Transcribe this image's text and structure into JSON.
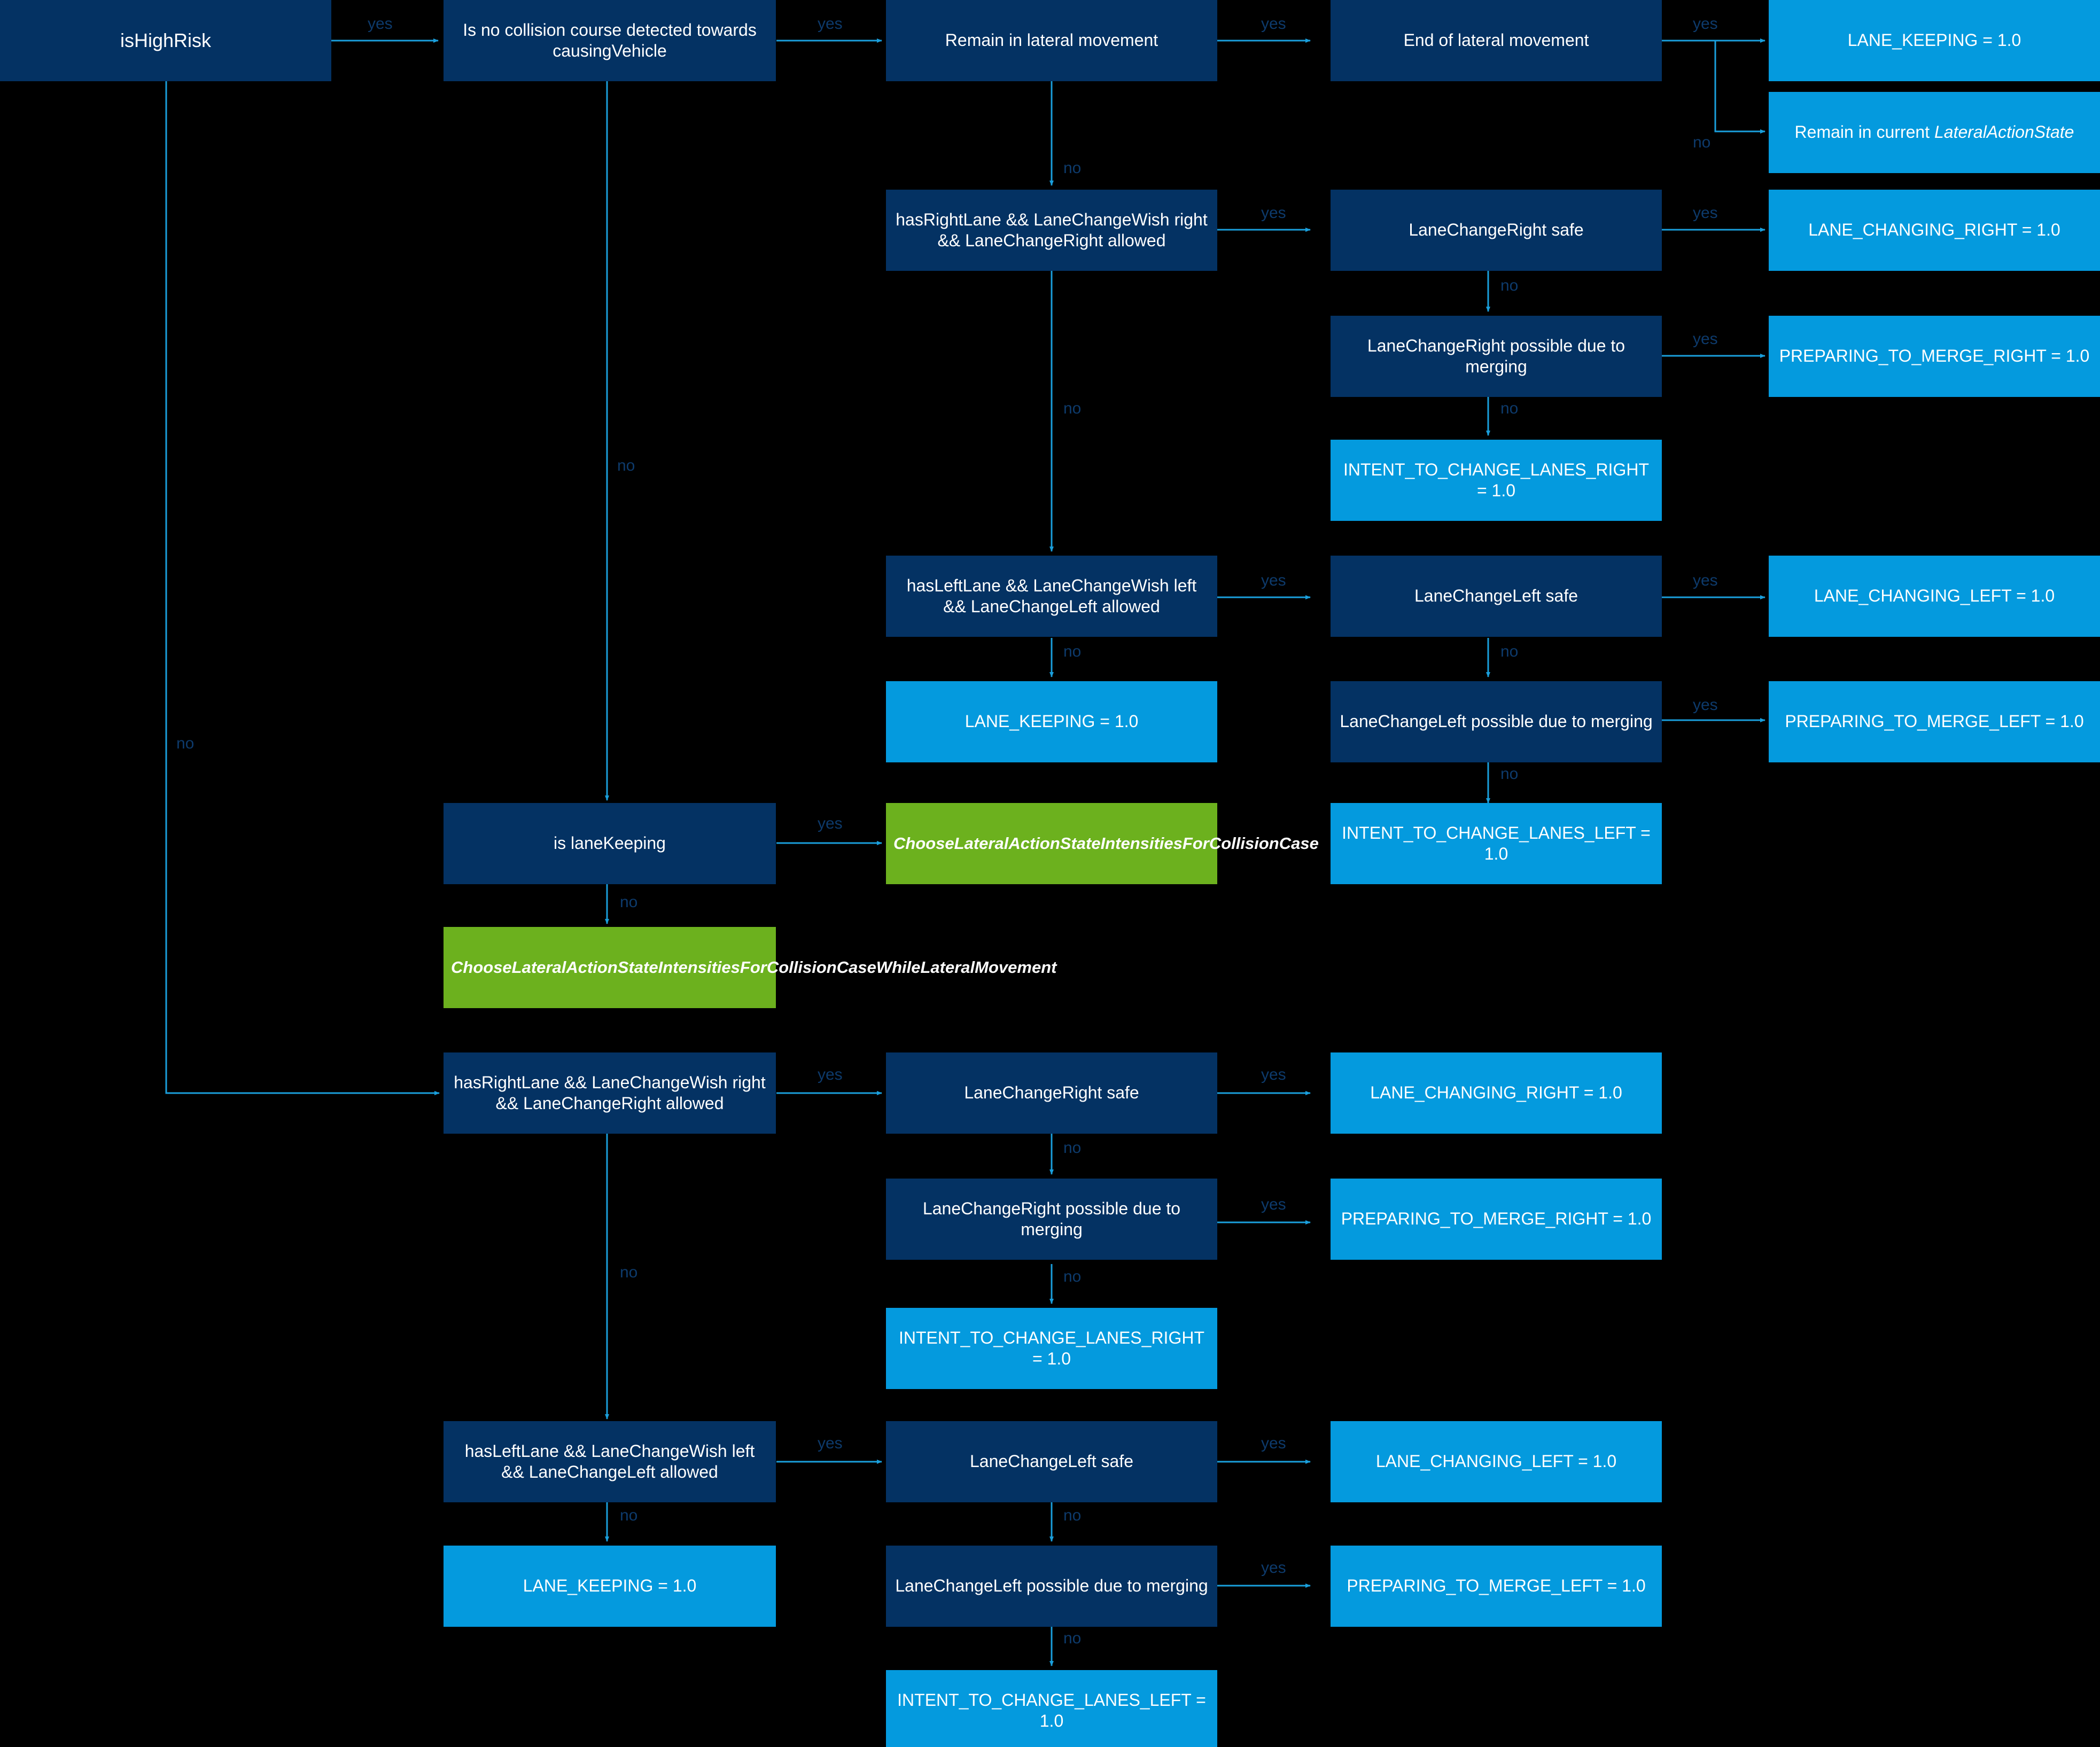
{
  "diagram": {
    "title": "LateralActionState decision flowchart",
    "background": "#000000",
    "colors": {
      "decision_box": "#043263",
      "outcome_box": "#049ade",
      "subroutine_box": "#6cb11e",
      "edge_line": "#1a9fdc",
      "edge_label": "#0d3a6b",
      "node_text": "#ffffff"
    },
    "nodes": [
      {
        "id": "isHighRisk",
        "label": "isHighRisk",
        "type": "decision"
      },
      {
        "id": "noCollisionCourse",
        "label": "Is no collision course detected towards causingVehicle",
        "type": "decision"
      },
      {
        "id": "remainLateral",
        "label": "Remain in lateral movement",
        "type": "decision"
      },
      {
        "id": "endLateral",
        "label": "End of lateral movement",
        "type": "decision"
      },
      {
        "id": "laneKeeping1",
        "label": "LANE_KEEPING = 1.0",
        "type": "outcome"
      },
      {
        "id": "remainCurrentState",
        "label": "Remain in current LateralActionState",
        "type": "outcome",
        "italic_tail": "LateralActionState"
      },
      {
        "id": "hasRightLaneA",
        "label": "hasRightLane && LaneChangeWish right && LaneChangeRight allowed",
        "type": "decision"
      },
      {
        "id": "lcrSafeA",
        "label": "LaneChangeRight safe",
        "type": "decision"
      },
      {
        "id": "laneChangingRightA",
        "label": "LANE_CHANGING_RIGHT = 1.0",
        "type": "outcome"
      },
      {
        "id": "lcrMergeA",
        "label": "LaneChangeRight possible due to merging",
        "type": "decision"
      },
      {
        "id": "prepMergeRightA",
        "label": "PREPARING_TO_MERGE_RIGHT = 1.0",
        "type": "outcome"
      },
      {
        "id": "intentRightA",
        "label": "INTENT_TO_CHANGE_LANES_RIGHT = 1.0",
        "type": "outcome"
      },
      {
        "id": "hasLeftLaneA",
        "label": "hasLeftLane && LaneChangeWish left && LaneChangeLeft allowed",
        "type": "decision"
      },
      {
        "id": "lclSafeA",
        "label": "LaneChangeLeft safe",
        "type": "decision"
      },
      {
        "id": "laneChangingLeftA",
        "label": "LANE_CHANGING_LEFT = 1.0",
        "type": "outcome"
      },
      {
        "id": "laneKeepingA",
        "label": "LANE_KEEPING = 1.0",
        "type": "outcome"
      },
      {
        "id": "lclMergeA",
        "label": "LaneChangeLeft possible due to merging",
        "type": "decision"
      },
      {
        "id": "prepMergeLeftA",
        "label": "PREPARING_TO_MERGE_LEFT = 1.0",
        "type": "outcome"
      },
      {
        "id": "intentLeftA",
        "label": "INTENT_TO_CHANGE_LANES_LEFT = 1.0",
        "type": "outcome"
      },
      {
        "id": "isLaneKeeping",
        "label": "is laneKeeping",
        "type": "decision"
      },
      {
        "id": "chooseCollision",
        "label": "ChooseLateralActionStateIntensitiesForCollisionCase",
        "type": "subroutine"
      },
      {
        "id": "chooseCollisionLateral",
        "label": "ChooseLateralActionStateIntensitiesForCollisionCaseWhileLateralMovement",
        "type": "subroutine"
      },
      {
        "id": "hasRightLaneB",
        "label": "hasRightLane && LaneChangeWish right && LaneChangeRight allowed",
        "type": "decision"
      },
      {
        "id": "lcrSafeB",
        "label": "LaneChangeRight safe",
        "type": "decision"
      },
      {
        "id": "laneChangingRightB",
        "label": "LANE_CHANGING_RIGHT = 1.0",
        "type": "outcome"
      },
      {
        "id": "lcrMergeB",
        "label": "LaneChangeRight possible due to merging",
        "type": "decision"
      },
      {
        "id": "prepMergeRightB",
        "label": "PREPARING_TO_MERGE_RIGHT = 1.0",
        "type": "outcome"
      },
      {
        "id": "intentRightB",
        "label": "INTENT_TO_CHANGE_LANES_RIGHT = 1.0",
        "type": "outcome"
      },
      {
        "id": "hasLeftLaneB",
        "label": "hasLeftLane && LaneChangeWish left && LaneChangeLeft allowed",
        "type": "decision"
      },
      {
        "id": "lclSafeB",
        "label": "LaneChangeLeft safe",
        "type": "decision"
      },
      {
        "id": "laneChangingLeftB",
        "label": "LANE_CHANGING_LEFT = 1.0",
        "type": "outcome"
      },
      {
        "id": "laneKeepingB",
        "label": "LANE_KEEPING = 1.0",
        "type": "outcome"
      },
      {
        "id": "lclMergeB",
        "label": "LaneChangeLeft possible due to merging",
        "type": "decision"
      },
      {
        "id": "prepMergeLeftB",
        "label": "PREPARING_TO_MERGE_LEFT = 1.0",
        "type": "outcome"
      },
      {
        "id": "intentLeftB",
        "label": "INTENT_TO_CHANGE_LANES_LEFT = 1.0",
        "type": "outcome"
      }
    ],
    "edge_labels": {
      "e1": "yes",
      "e2": "no",
      "e3": "yes",
      "e4": "no",
      "e5": "yes",
      "e6": "no",
      "e7": "yes",
      "e8": "no",
      "e9": "yes",
      "e10": "no",
      "e11": "yes",
      "e12": "no",
      "e13": "yes",
      "e14": "no",
      "e15": "yes",
      "e16": "no",
      "e17": "yes",
      "e18": "no",
      "e19": "yes",
      "e20": "no",
      "e21": "yes",
      "e22": "no",
      "e23": "yes",
      "e24": "no",
      "e25": "yes",
      "e26": "no",
      "e27": "yes",
      "e28": "no",
      "e29": "yes",
      "e30": "no",
      "e31": "yes",
      "e32": "no",
      "e33": "yes",
      "e34": "no"
    }
  }
}
